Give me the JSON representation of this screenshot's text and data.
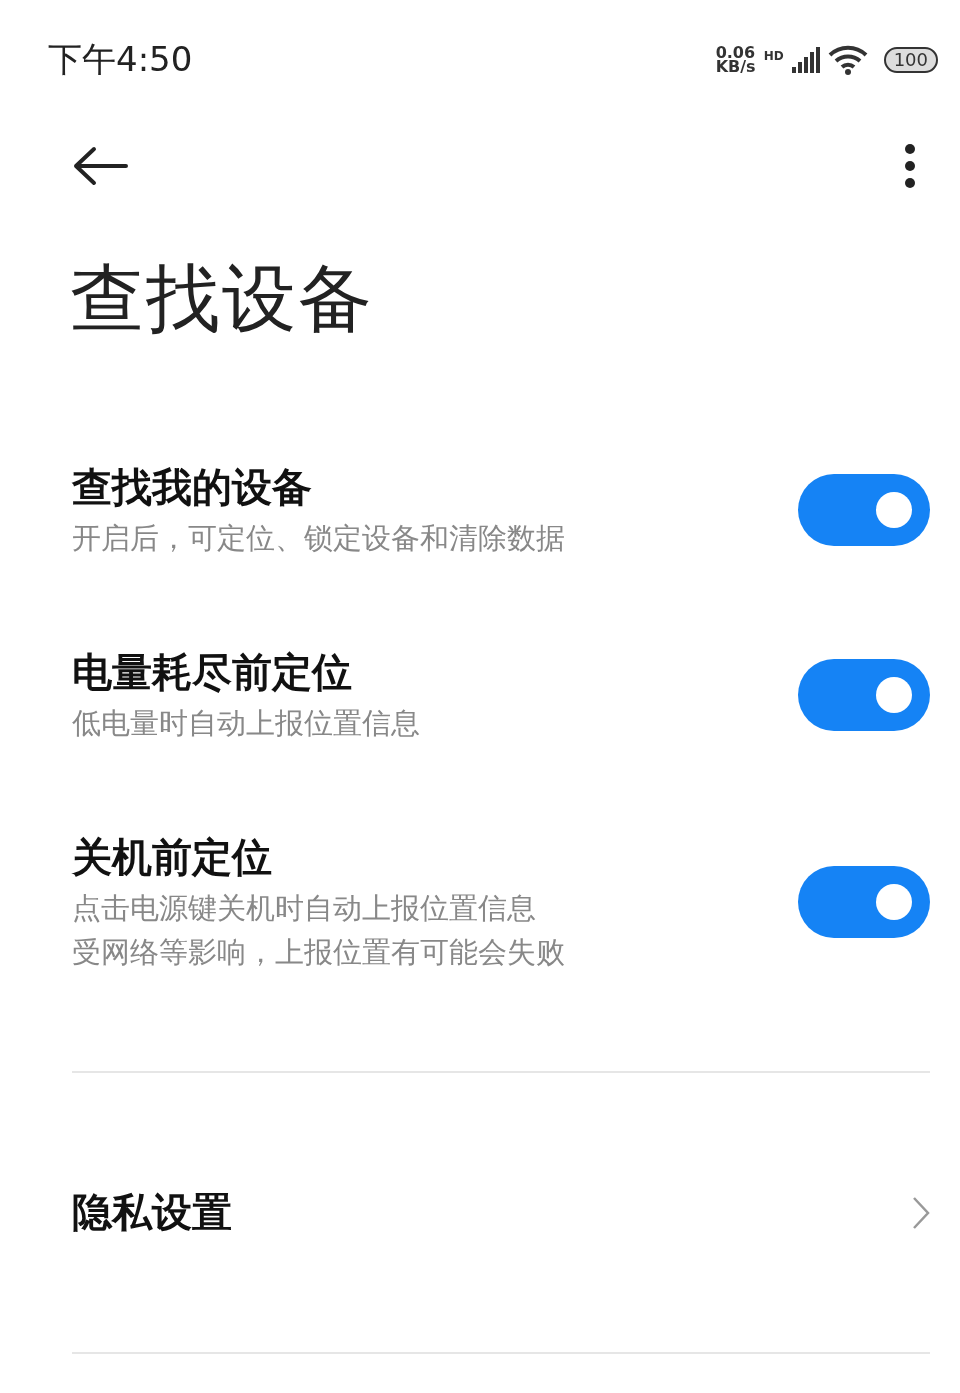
{
  "status_bar": {
    "time": "下午4:50",
    "net_speed": "0.06",
    "net_unit": "KB/s",
    "network_badge": "HD",
    "battery": "100"
  },
  "header": {
    "title": "查找设备"
  },
  "settings": [
    {
      "title": "查找我的设备",
      "lines": [
        "开启后，可定位、锁定设备和清除数据"
      ],
      "on": true
    },
    {
      "title": "电量耗尽前定位",
      "lines": [
        "低电量时自动上报位置信息"
      ],
      "on": true
    },
    {
      "title": "关机前定位",
      "lines": [
        "点击电源键关机时自动上报位置信息",
        "受网络等影响，上报位置有可能会失败"
      ],
      "on": true
    }
  ],
  "links": [
    {
      "title": "隐私设置"
    }
  ]
}
